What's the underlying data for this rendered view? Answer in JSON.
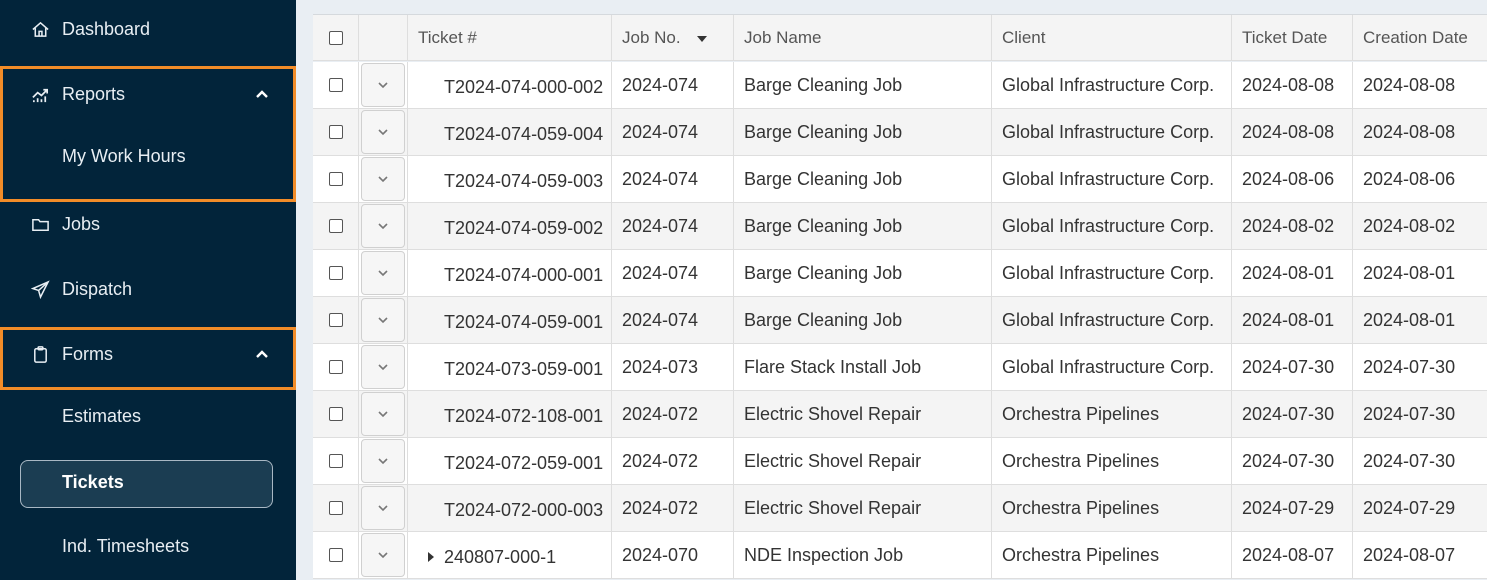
{
  "sidebar": {
    "items": [
      {
        "label": "Dashboard",
        "icon": "home-icon"
      },
      {
        "label": "Reports",
        "icon": "chart-icon"
      },
      {
        "label": "My Work Hours"
      },
      {
        "label": "Jobs",
        "icon": "folder-icon"
      },
      {
        "label": "Dispatch",
        "icon": "send-icon"
      },
      {
        "label": "Forms",
        "icon": "clipboard-icon"
      },
      {
        "label": "Estimates"
      },
      {
        "label": "Tickets"
      },
      {
        "label": "Ind. Timesheets"
      }
    ],
    "highlight_color": "#f28c28",
    "bg_color": "#02243a"
  },
  "table": {
    "headers": [
      "Ticket #",
      "Job No.",
      "Job Name",
      "Client",
      "Ticket Date",
      "Creation Date"
    ],
    "rows": [
      {
        "ticket": "T2024-074-000-002",
        "job_no": "2024-074",
        "job_name": "Barge Cleaning Job",
        "client": "Global Infrastructure Corp.",
        "ticket_date": "2024-08-08",
        "creation_date": "2024-08-08"
      },
      {
        "ticket": "T2024-074-059-004",
        "job_no": "2024-074",
        "job_name": "Barge Cleaning Job",
        "client": "Global Infrastructure Corp.",
        "ticket_date": "2024-08-08",
        "creation_date": "2024-08-08"
      },
      {
        "ticket": "T2024-074-059-003",
        "job_no": "2024-074",
        "job_name": "Barge Cleaning Job",
        "client": "Global Infrastructure Corp.",
        "ticket_date": "2024-08-06",
        "creation_date": "2024-08-06"
      },
      {
        "ticket": "T2024-074-059-002",
        "job_no": "2024-074",
        "job_name": "Barge Cleaning Job",
        "client": "Global Infrastructure Corp.",
        "ticket_date": "2024-08-02",
        "creation_date": "2024-08-02"
      },
      {
        "ticket": "T2024-074-000-001",
        "job_no": "2024-074",
        "job_name": "Barge Cleaning Job",
        "client": "Global Infrastructure Corp.",
        "ticket_date": "2024-08-01",
        "creation_date": "2024-08-01"
      },
      {
        "ticket": "T2024-074-059-001",
        "job_no": "2024-074",
        "job_name": "Barge Cleaning Job",
        "client": "Global Infrastructure Corp.",
        "ticket_date": "2024-08-01",
        "creation_date": "2024-08-01"
      },
      {
        "ticket": "T2024-073-059-001",
        "job_no": "2024-073",
        "job_name": "Flare Stack Install Job",
        "client": "Global Infrastructure Corp.",
        "ticket_date": "2024-07-30",
        "creation_date": "2024-07-30"
      },
      {
        "ticket": "T2024-072-108-001",
        "job_no": "2024-072",
        "job_name": "Electric Shovel Repair",
        "client": "Orchestra Pipelines",
        "ticket_date": "2024-07-30",
        "creation_date": "2024-07-30"
      },
      {
        "ticket": "T2024-072-059-001",
        "job_no": "2024-072",
        "job_name": "Electric Shovel Repair",
        "client": "Orchestra Pipelines",
        "ticket_date": "2024-07-30",
        "creation_date": "2024-07-30"
      },
      {
        "ticket": "T2024-072-000-003",
        "job_no": "2024-072",
        "job_name": "Electric Shovel Repair",
        "client": "Orchestra Pipelines",
        "ticket_date": "2024-07-29",
        "creation_date": "2024-07-29"
      },
      {
        "ticket": "240807-000-1",
        "job_no": "2024-070",
        "job_name": "NDE Inspection Job",
        "client": "Orchestra Pipelines",
        "ticket_date": "2024-08-07",
        "creation_date": "2024-08-07"
      }
    ]
  }
}
